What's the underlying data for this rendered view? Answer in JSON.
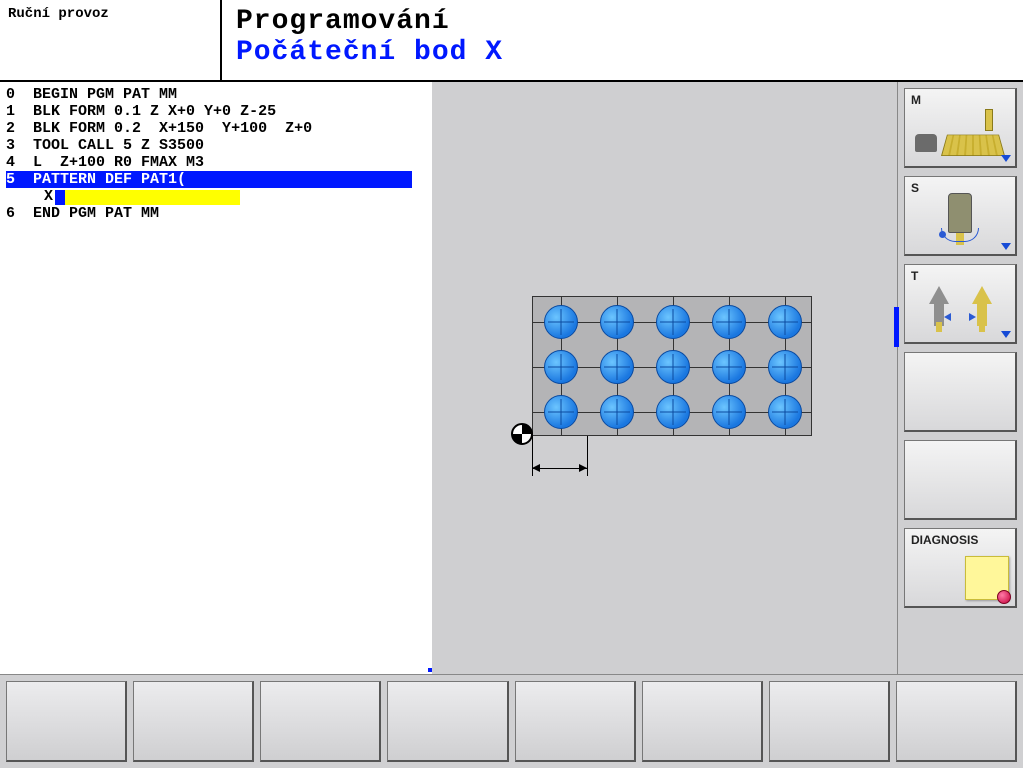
{
  "header": {
    "mode_label": "Ruční provoz",
    "title": "Programování",
    "subtitle": "Počáteční bod X"
  },
  "program": {
    "lines": [
      {
        "n": "0",
        "text": "BEGIN PGM PAT MM"
      },
      {
        "n": "1",
        "text": "BLK FORM 0.1 Z X+0 Y+0 Z-25"
      },
      {
        "n": "2",
        "text": "BLK FORM 0.2  X+150  Y+100  Z+0"
      },
      {
        "n": "3",
        "text": "TOOL CALL 5 Z S3500"
      },
      {
        "n": "4",
        "text": "L  Z+100 R0 FMAX M3"
      },
      {
        "n": "5",
        "text": "PATTERN DEF PAT1(",
        "selected": true
      },
      {
        "n": "6",
        "text": "END PGM PAT MM"
      }
    ],
    "active_param_label": "X",
    "active_param_value": ""
  },
  "pattern_preview": {
    "cols": 5,
    "rows": 3,
    "origin_marker": true,
    "spacing_indicator": true
  },
  "sidebar": {
    "buttons": [
      {
        "id": "m",
        "label": "M"
      },
      {
        "id": "s",
        "label": "S"
      },
      {
        "id": "t",
        "label": "T"
      },
      {
        "id": "empty1",
        "label": ""
      },
      {
        "id": "empty2",
        "label": ""
      },
      {
        "id": "diagnosis",
        "label": "DIAGNOSIS"
      }
    ]
  },
  "softkeys": [
    "",
    "",
    "",
    "",
    "",
    "",
    "",
    ""
  ]
}
